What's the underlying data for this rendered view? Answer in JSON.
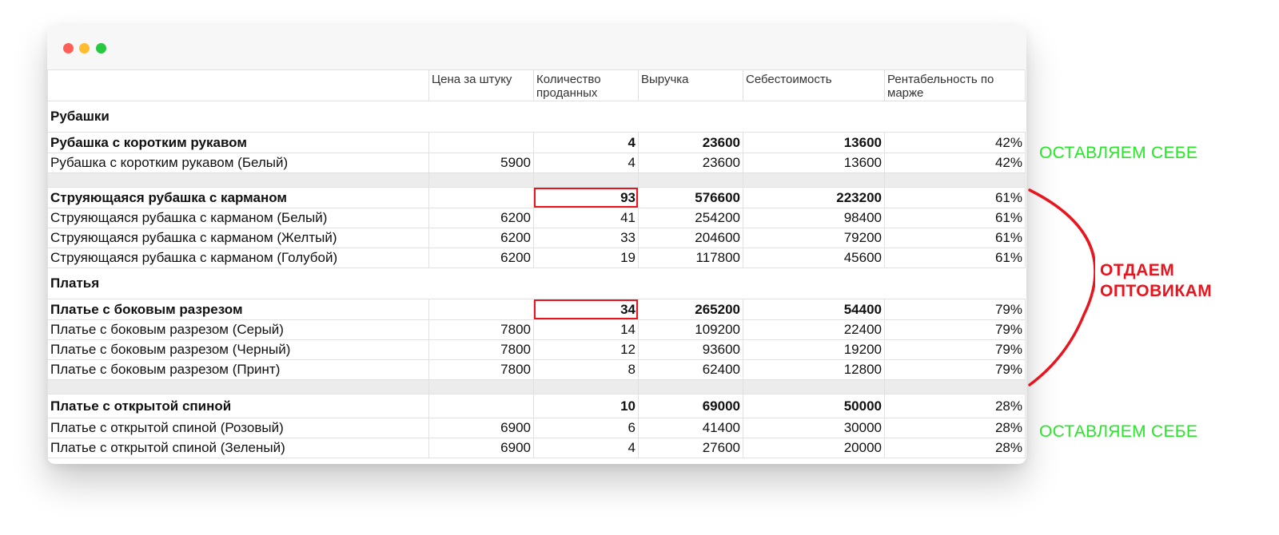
{
  "headers": [
    "",
    "Цена за штуку",
    "Количество проданных",
    "Выручка",
    "Себестоимость",
    "Рентабельность по марже"
  ],
  "sections": {
    "shirts_title": "Рубашки",
    "dresses_title": "Платья"
  },
  "rows": {
    "r1": {
      "name": "Рубашка с коротким рукавом",
      "price": "",
      "qty": "4",
      "revenue": "23600",
      "cost": "13600",
      "margin": "42%"
    },
    "r2": {
      "name": "Рубашка с коротким рукавом (Белый)",
      "price": "5900",
      "qty": "4",
      "revenue": "23600",
      "cost": "13600",
      "margin": "42%"
    },
    "r3": {
      "name": "Струяющаяся рубашка с карманом",
      "price": "",
      "qty": "93",
      "revenue": "576600",
      "cost": "223200",
      "margin": "61%"
    },
    "r4": {
      "name": "Струяющаяся рубашка с карманом (Белый)",
      "price": "6200",
      "qty": "41",
      "revenue": "254200",
      "cost": "98400",
      "margin": "61%"
    },
    "r5": {
      "name": "Струяющаяся рубашка с карманом (Желтый)",
      "price": "6200",
      "qty": "33",
      "revenue": "204600",
      "cost": "79200",
      "margin": "61%"
    },
    "r6": {
      "name": "Струяющаяся рубашка с карманом (Голубой)",
      "price": "6200",
      "qty": "19",
      "revenue": "117800",
      "cost": "45600",
      "margin": "61%"
    },
    "r7": {
      "name": "Платье с боковым разрезом",
      "price": "",
      "qty": "34",
      "revenue": "265200",
      "cost": "54400",
      "margin": "79%"
    },
    "r8": {
      "name": "Платье с боковым разрезом (Серый)",
      "price": "7800",
      "qty": "14",
      "revenue": "109200",
      "cost": "22400",
      "margin": "79%"
    },
    "r9": {
      "name": "Платье с боковым разрезом (Черный)",
      "price": "7800",
      "qty": "12",
      "revenue": "93600",
      "cost": "19200",
      "margin": "79%"
    },
    "r10": {
      "name": "Платье с боковым разрезом (Принт)",
      "price": "7800",
      "qty": "8",
      "revenue": "62400",
      "cost": "12800",
      "margin": "79%"
    },
    "r11": {
      "name": "Платье с открытой спиной",
      "price": "",
      "qty": "10",
      "revenue": "69000",
      "cost": "50000",
      "margin": "28%"
    },
    "r12": {
      "name": "Платье с открытой спиной (Розовый)",
      "price": "6900",
      "qty": "6",
      "revenue": "41400",
      "cost": "30000",
      "margin": "28%"
    },
    "r13": {
      "name": "Платье с открытой спиной (Зеленый)",
      "price": "6900",
      "qty": "4",
      "revenue": "27600",
      "cost": "20000",
      "margin": "28%"
    }
  },
  "annotations": {
    "keep_top": "ОСТАВЛЯЕМ СЕБЕ",
    "wholesale_line1": "ОТДАЕМ",
    "wholesale_line2": "ОПТОВИКАМ",
    "keep_bottom": "ОСТАВЛЯЕМ СЕБЕ"
  },
  "colors": {
    "highlight": "#e8141e",
    "keep_note": "#27e627",
    "wholesale_note": "#e8141e"
  }
}
